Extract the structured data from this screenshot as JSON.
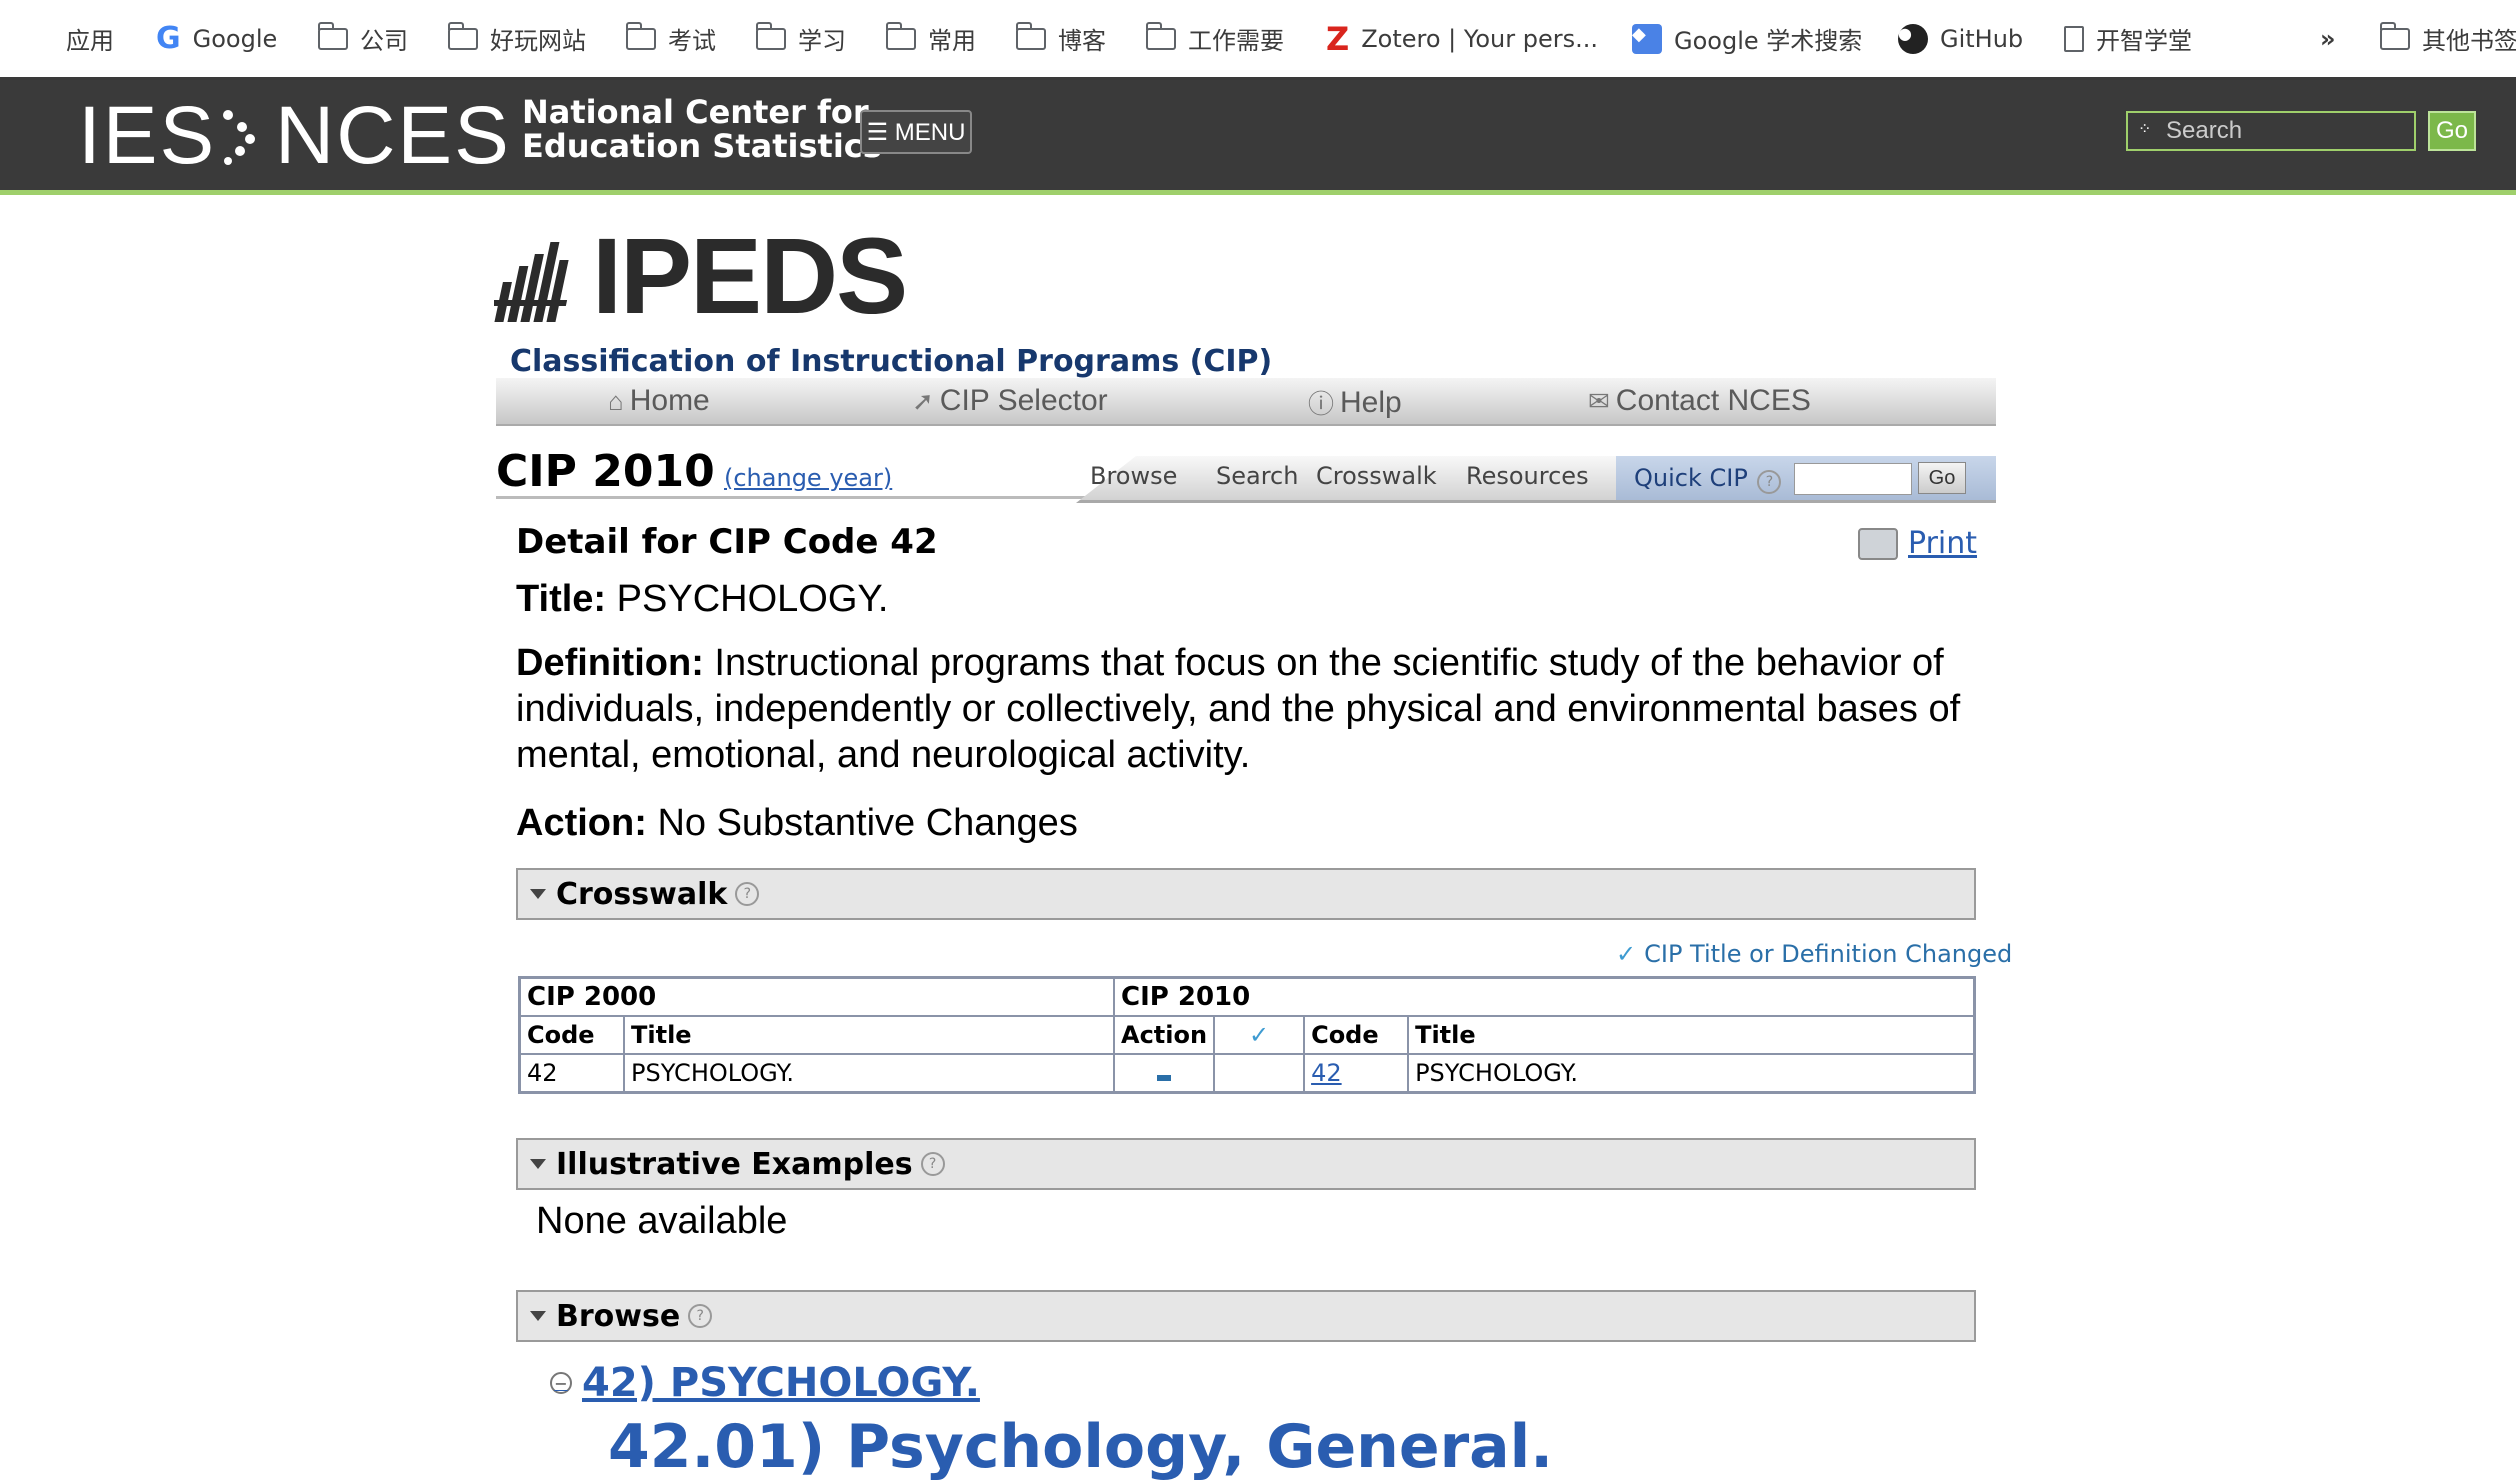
{
  "bookmarks": {
    "items": [
      {
        "label": "应用",
        "icon": "apps-grid-icon"
      },
      {
        "label": "Google",
        "icon": "google-icon"
      },
      {
        "label": "公司",
        "icon": "folder-icon"
      },
      {
        "label": "好玩网站",
        "icon": "folder-icon"
      },
      {
        "label": "考试",
        "icon": "folder-icon"
      },
      {
        "label": "学习",
        "icon": "folder-icon"
      },
      {
        "label": "常用",
        "icon": "folder-icon"
      },
      {
        "label": "博客",
        "icon": "folder-icon"
      },
      {
        "label": "工作需要",
        "icon": "folder-icon"
      },
      {
        "label": "Zotero | Your pers...",
        "icon": "zotero-icon"
      },
      {
        "label": "Google 学术搜索",
        "icon": "scholar-icon"
      },
      {
        "label": "GitHub",
        "icon": "github-icon"
      },
      {
        "label": "开智学堂",
        "icon": "page-icon"
      }
    ],
    "overflow": "»",
    "other": "其他书签"
  },
  "banner": {
    "logo_ies": "IES",
    "logo_nces": "NCES",
    "subtitle_line1": "National Center for",
    "subtitle_line2": "Education Statistics",
    "menu_label": "☰ MENU",
    "search_placeholder": "Search",
    "go_label": "Go",
    "accent": "#9fcf6b"
  },
  "ipeds": {
    "logo_text": "IPEDS",
    "subtitle": "Classification of Instructional Programs (CIP)",
    "nav": [
      {
        "label": "Home",
        "icon": "home-icon"
      },
      {
        "label": "CIP Selector",
        "icon": "pointer-icon"
      },
      {
        "label": "Help",
        "icon": "help-icon"
      },
      {
        "label": "Contact NCES",
        "icon": "mail-icon"
      }
    ]
  },
  "cipbar": {
    "year_title": "CIP 2010",
    "change_year": "(change year)",
    "tabs": [
      "Browse",
      "Search",
      "Crosswalk",
      "Resources"
    ],
    "quick_cip": "Quick CIP",
    "go": "Go"
  },
  "detail": {
    "heading": "Detail for CIP Code 42",
    "print": "Print",
    "title_label": "Title:",
    "title_value": "PSYCHOLOGY.",
    "definition_label": "Definition:",
    "definition_value": "Instructional programs that focus on the scientific study of the behavior of individuals, independently or collectively, and the physical and environmental bases of mental, emotional, and neurological activity.",
    "action_label": "Action:",
    "action_value": "No Substantive Changes"
  },
  "crosswalk": {
    "heading": "Crosswalk",
    "legend": "CIP Title or Definition Changed",
    "group_left": "CIP 2000",
    "group_right": "CIP 2010",
    "columns": [
      "Code",
      "Title",
      "Action",
      "✓",
      "Code",
      "Title"
    ],
    "rows": [
      {
        "code_2000": "42",
        "title_2000": "PSYCHOLOGY.",
        "code_2010": "42",
        "title_2010": "PSYCHOLOGY."
      }
    ]
  },
  "examples": {
    "heading": "Illustrative Examples",
    "none": "None available"
  },
  "browse": {
    "heading": "Browse",
    "link": "42) PSYCHOLOGY.",
    "sub": "42.01) Psychology, General."
  }
}
